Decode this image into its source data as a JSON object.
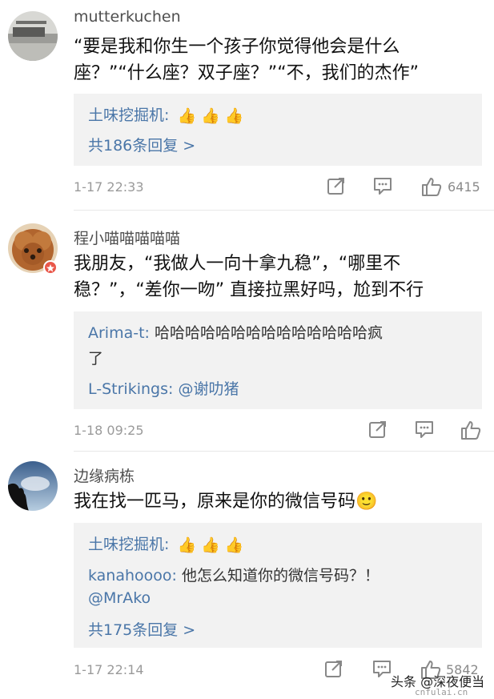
{
  "comments": [
    {
      "username": "mutterkuchen",
      "body_lines": [
        "“要是我和你生一个孩子你觉得他会是什么",
        "座？”“什么座？双子座？”“不，我们的杰作”"
      ],
      "replies": [
        {
          "name": "土味挖掘机:",
          "text": ""
        }
      ],
      "more": "共186条回复 >",
      "time": "1-17 22:33",
      "likes": "6415"
    },
    {
      "username": "程小喵喵喵喵喵",
      "body_lines": [
        "我朋友，“我做人一向十拿九稳”，“哪里不",
        "稳？”，“差你一吻” 直接拉黑好吗，尬到不行"
      ],
      "replies": [
        {
          "name": "Arima-t:",
          "text": "哈哈哈哈哈哈哈哈哈哈哈哈哈哈疯"
        },
        {
          "name": "",
          "text": "了"
        },
        {
          "name": "L-Strikings:",
          "text": "@谢叻猪"
        }
      ],
      "more": "",
      "time": "1-18 09:25",
      "likes": ""
    },
    {
      "username": "边缘病栋",
      "body_lines": [
        "我在找一匹马，原来是你的微信号码"
      ],
      "replies": [
        {
          "name": "土味挖掘机:",
          "text": ""
        },
        {
          "name": "kanahoooo:",
          "text": "他怎么知道你的微信号码？！"
        },
        {
          "name": "",
          "text": "@MrAko"
        }
      ],
      "more": "共175条回复 >",
      "time": "1-17 22:14",
      "likes": "5842"
    }
  ],
  "icons": {
    "thumbs_emoji": "👍",
    "smile_emoji": "🙂"
  },
  "watermark": {
    "label": "头条 @深夜便当",
    "url": "cnfulai.cn"
  },
  "colors": {
    "link": "#4a76a8",
    "reply_bg": "#f2f2f2",
    "meta": "#9a9a9a"
  }
}
